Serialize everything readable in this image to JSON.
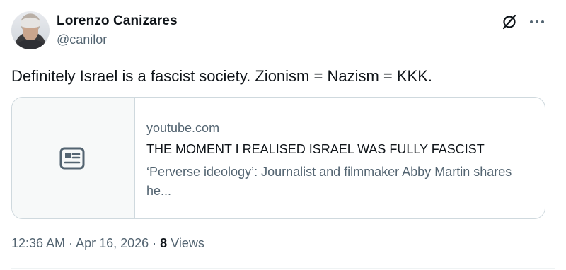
{
  "author": {
    "name": "Lorenzo Canizares",
    "handle": "@canilor",
    "avatar_icon": "user-avatar-photo"
  },
  "header_actions": {
    "grok_icon": "grok-slash-circle-icon",
    "more_icon": "more-horizontal-icon"
  },
  "tweet": {
    "text": "Definitely Israel is a fascist society. Zionism = Nazism = KKK."
  },
  "link_card": {
    "media_icon": "article-icon",
    "domain": "youtube.com",
    "title": "THE MOMENT I REALISED ISRAEL WAS FULLY FASCIST",
    "description": "‘Perverse ideology’: Journalist and filmmaker Abby Martin shares he..."
  },
  "meta": {
    "time": "12:36 AM",
    "separator1": " · ",
    "date": "Apr 16, 2026",
    "separator2": " · ",
    "views_count": "8",
    "views_label": " Views"
  },
  "colors": {
    "text_primary": "#0f1419",
    "text_secondary": "#536471",
    "border": "#cfd9de",
    "card_media_bg": "#f7f9f9"
  }
}
